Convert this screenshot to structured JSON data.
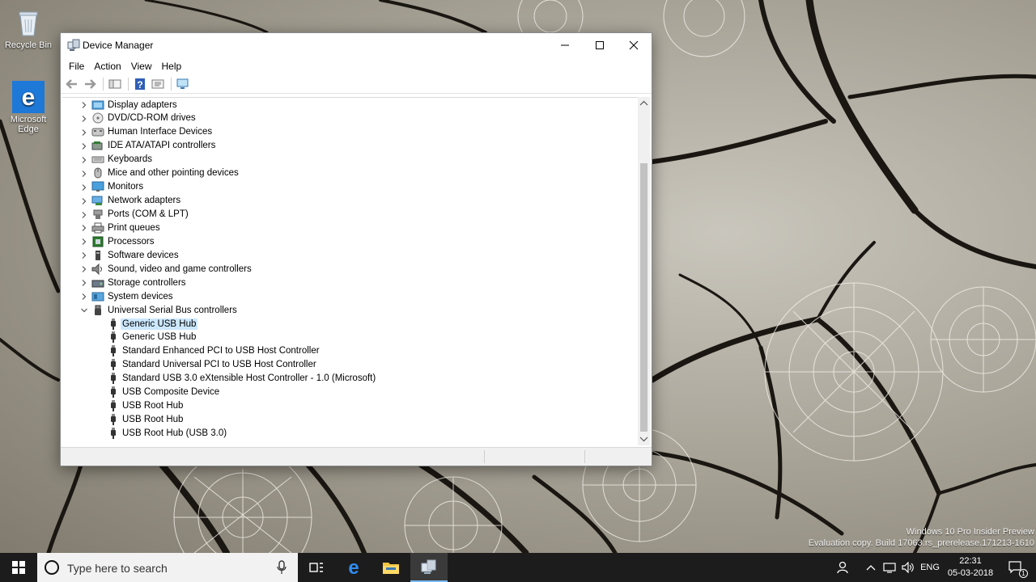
{
  "desktop": {
    "icons": [
      {
        "label": "Recycle Bin"
      },
      {
        "label": "Microsoft Edge"
      }
    ],
    "watermark": {
      "line1": "Windows 10 Pro Insider Preview",
      "line2": "Evaluation copy. Build 17063.rs_prerelease.171213-1610"
    }
  },
  "window": {
    "title": "Device Manager",
    "menu": [
      "File",
      "Action",
      "View",
      "Help"
    ],
    "tree": {
      "categories": [
        {
          "label": "Display adapters",
          "icon": "display-adapter-icon",
          "expanded": false
        },
        {
          "label": "DVD/CD-ROM drives",
          "icon": "dvd-drive-icon",
          "expanded": false
        },
        {
          "label": "Human Interface Devices",
          "icon": "hid-icon",
          "expanded": false
        },
        {
          "label": "IDE ATA/ATAPI controllers",
          "icon": "ide-controller-icon",
          "expanded": false
        },
        {
          "label": "Keyboards",
          "icon": "keyboard-icon",
          "expanded": false
        },
        {
          "label": "Mice and other pointing devices",
          "icon": "mouse-icon",
          "expanded": false
        },
        {
          "label": "Monitors",
          "icon": "monitor-icon",
          "expanded": false
        },
        {
          "label": "Network adapters",
          "icon": "network-adapter-icon",
          "expanded": false
        },
        {
          "label": "Ports (COM & LPT)",
          "icon": "port-icon",
          "expanded": false
        },
        {
          "label": "Print queues",
          "icon": "printer-icon",
          "expanded": false
        },
        {
          "label": "Processors",
          "icon": "processor-icon",
          "expanded": false
        },
        {
          "label": "Software devices",
          "icon": "software-device-icon",
          "expanded": false
        },
        {
          "label": "Sound, video and game controllers",
          "icon": "speaker-icon",
          "expanded": false
        },
        {
          "label": "Storage controllers",
          "icon": "storage-controller-icon",
          "expanded": false
        },
        {
          "label": "System devices",
          "icon": "system-device-icon",
          "expanded": false
        },
        {
          "label": "Universal Serial Bus controllers",
          "icon": "usb-icon",
          "expanded": true
        }
      ],
      "usb_children": [
        {
          "label": "Generic USB Hub",
          "selected": true
        },
        {
          "label": "Generic USB Hub"
        },
        {
          "label": "Standard Enhanced PCI to USB Host Controller"
        },
        {
          "label": "Standard Universal PCI to USB Host Controller"
        },
        {
          "label": "Standard USB 3.0 eXtensible Host Controller - 1.0 (Microsoft)"
        },
        {
          "label": "USB Composite Device"
        },
        {
          "label": "USB Root Hub"
        },
        {
          "label": "USB Root Hub"
        },
        {
          "label": "USB Root Hub (USB 3.0)"
        }
      ]
    }
  },
  "taskbar": {
    "search_placeholder": "Type here to search",
    "language": "ENG",
    "time": "22:31",
    "date": "05-03-2018",
    "notification_count": "1"
  },
  "colors": {
    "selection": "#cce8ff",
    "taskbar": "#1c1c1c",
    "edge_blue": "#1e78d7"
  }
}
